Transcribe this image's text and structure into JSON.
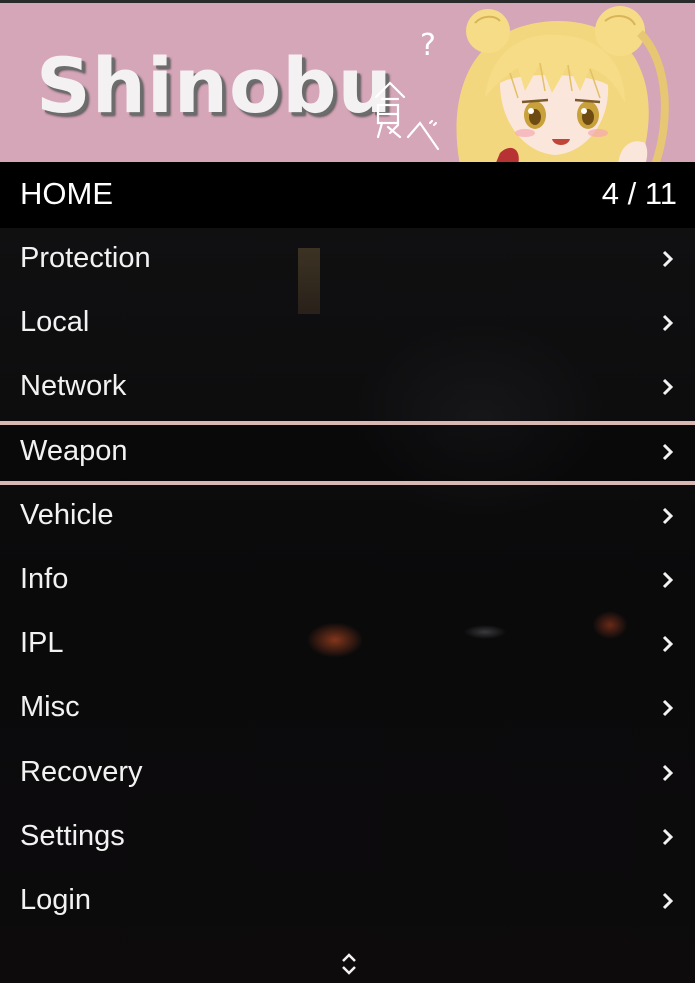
{
  "header": {
    "title": "Shinobu",
    "doodle_text": "食べ",
    "doodle_mark": "?",
    "banner_color": "#d5a5b8"
  },
  "submenu": {
    "label": "HOME",
    "position": "4 / 11"
  },
  "menu": {
    "selected_index": 3,
    "items": [
      {
        "label": "Protection",
        "icon": "chevron-right-icon"
      },
      {
        "label": "Local",
        "icon": "chevron-right-icon"
      },
      {
        "label": "Network",
        "icon": "chevron-right-icon"
      },
      {
        "label": "Weapon",
        "icon": "chevron-right-icon"
      },
      {
        "label": "Vehicle",
        "icon": "chevron-right-icon"
      },
      {
        "label": "Info",
        "icon": "chevron-right-icon"
      },
      {
        "label": "IPL",
        "icon": "chevron-right-icon"
      },
      {
        "label": "Misc",
        "icon": "chevron-right-icon"
      },
      {
        "label": "Recovery",
        "icon": "chevron-right-icon"
      },
      {
        "label": "Settings",
        "icon": "chevron-right-icon"
      },
      {
        "label": "Login",
        "icon": "chevron-right-icon"
      }
    ]
  },
  "footer": {
    "icon": "scroll-updown-icon"
  },
  "colors": {
    "selection_border": "#d9b8b3",
    "text": "#f2f2f2",
    "bar": "#000000"
  }
}
